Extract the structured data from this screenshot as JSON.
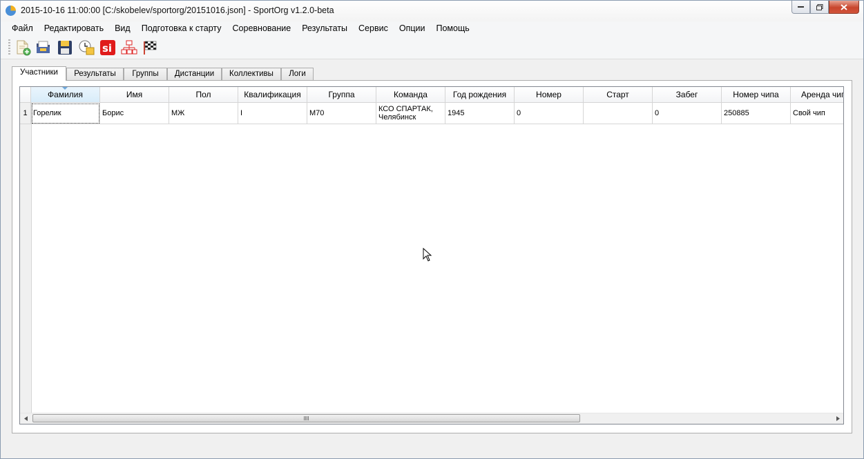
{
  "window": {
    "title": "2015-10-16 11:00:00 [C:/skobelev/sportorg/20151016.json] - SportOrg v1.2.0-beta"
  },
  "menu": [
    "Файл",
    "Редактировать",
    "Вид",
    "Подготовка к старту",
    "Соревнование",
    "Результаты",
    "Сервис",
    "Опции",
    "Помощь"
  ],
  "toolbar": {
    "buttons": [
      "new-file-icon",
      "open-folder-icon",
      "save-icon",
      "start-time-icon",
      "si-reader-icon",
      "relay-tree-icon",
      "finish-flag-icon"
    ]
  },
  "tabs": [
    "Участники",
    "Результаты",
    "Группы",
    "Дистанции",
    "Коллективы",
    "Логи"
  ],
  "active_tab": "Участники",
  "table": {
    "columns": [
      "Фамилия",
      "Имя",
      "Пол",
      "Квалификация",
      "Группа",
      "Команда",
      "Год рождения",
      "Номер",
      "Старт",
      "Забег",
      "Номер чипа",
      "Аренда чип"
    ],
    "rows": [
      {
        "index": "1",
        "cells": [
          "Горелик",
          "Борис",
          "МЖ",
          "I",
          "М70",
          "КСО СПАРТАК, Челябинск",
          "1945",
          "0",
          "",
          "0",
          "250885",
          "Свой чип"
        ]
      }
    ]
  },
  "colors": {
    "close_button": "#c8462d",
    "sorted_header": "#d8ecf9",
    "si_red": "#e01b1b"
  }
}
